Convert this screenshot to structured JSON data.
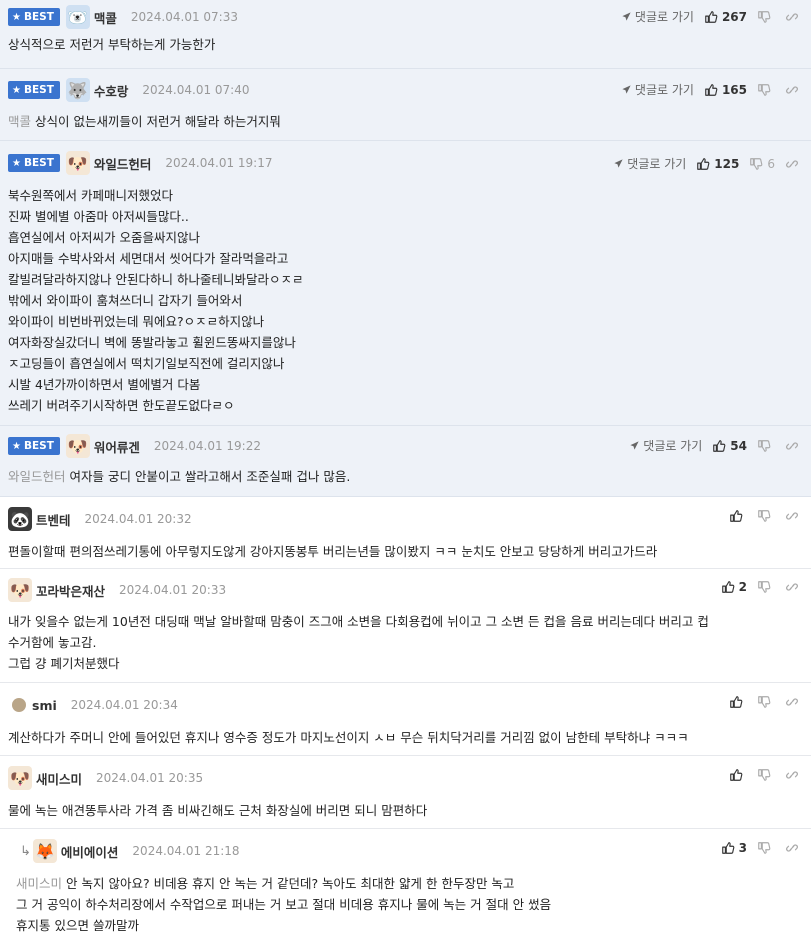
{
  "labels": {
    "best": "BEST",
    "reply_to": "댓글로 가기"
  },
  "comments": [
    {
      "nick": "맥콜",
      "date": "2024.04.01 07:33",
      "likes": "267",
      "dislikes": "",
      "mention": "",
      "lines": [
        "상식적으로 저런거 부탁하는게 가능한가"
      ]
    },
    {
      "nick": "수호랑",
      "date": "2024.04.01 07:40",
      "likes": "165",
      "dislikes": "",
      "mention": "맥콜",
      "lines": [
        "상식이 없는새끼들이 저런거 해달라 하는거지뭐"
      ]
    },
    {
      "nick": "와일드헌터",
      "date": "2024.04.01 19:17",
      "likes": "125",
      "dislikes": "6",
      "mention": "",
      "lines": [
        "북수원쪽에서 카페매니저했었다",
        "진짜 별에별 아줌마 아저씨들많다..",
        "흡연실에서 아저씨가 오줌을싸지않나",
        "아지매들 수박사와서 세면대서 씻어다가 잘라먹을라고",
        "칼빌려달라하지않나 안된다하니 하나줄테니봐달라ㅇㅈㄹ",
        "밖에서 와이파이 훔쳐쓰더니 갑자기 들어와서",
        "와이파이 비번바뀌었는데 뭐에요?ㅇㅈㄹ하지않나",
        "여자화장실갔더니 벽에 똥발라놓고 휠윈드똥싸지를않나",
        "ㅈ고딩들이 흡연실에서 떡치기일보직전에 걸리지않나",
        "시발 4년가까이하면서 별에별거 다봄",
        "쓰레기 버려주기시작하면 한도끝도없다ㄹㅇ"
      ]
    },
    {
      "nick": "워어류겐",
      "date": "2024.04.01 19:22",
      "likes": "54",
      "dislikes": "",
      "mention": "와일드헌터",
      "lines": [
        "여자들 궁디 안붙이고 쌀라고해서 조준실패 겁나 많음."
      ]
    },
    {
      "nick": "트벤테",
      "date": "2024.04.01 20:32",
      "likes": "",
      "dislikes": "",
      "mention": "",
      "lines": [
        "편돌이할때 편의점쓰레기통에 아무렇지도않게 강아지똥봉투 버리는년들 많이봤지 ㅋㅋ 눈치도 안보고 당당하게 버리고가드라"
      ]
    },
    {
      "nick": "꼬라박은재산",
      "date": "2024.04.01 20:33",
      "likes": "2",
      "dislikes": "",
      "mention": "",
      "lines": [
        "내가 잊을수 없는게 10년전 대딩때 맥날 알바할때 맘충이 즈그애 소변을 다회용컵에 뉘이고 그 소변 든 컵을 음료 버리는데다 버리고 컵",
        "수거함에 놓고감.",
        "그럽 걍 폐기처분했다"
      ]
    },
    {
      "nick": "smi",
      "date": "2024.04.01 20:34",
      "likes": "",
      "dislikes": "",
      "mention": "",
      "lines": [
        "계산하다가 주머니 안에 들어있던 휴지나 영수증 정도가 마지노선이지 ㅅㅂ 무슨 뒤치닥거리를 거리낌 없이 남한테 부탁하냐 ㅋㅋㅋ"
      ]
    },
    {
      "nick": "새미스미",
      "date": "2024.04.01 20:35",
      "likes": "",
      "dislikes": "",
      "mention": "",
      "lines": [
        "물에 녹는 애견똥투사라 가격 좀 비싸긴해도 근처 화장실에 버리면 되니 맘편하다"
      ]
    },
    {
      "nick": "에비에이션",
      "date": "2024.04.01 21:18",
      "likes": "3",
      "dislikes": "",
      "mention": "새미스미",
      "lines": [
        "안 녹지 않아요? 비데용 휴지 안 녹는 거 같던데? 녹아도 최대한 얇게 한 한두장만 녹고",
        "그 거 공익이 하수처리장에서 수작업으로 퍼내는 거 보고 절대 비데용 휴지나 물에 녹는 거 절대 안 썼음",
        "휴지통 있으면 쓸까말까"
      ]
    }
  ]
}
